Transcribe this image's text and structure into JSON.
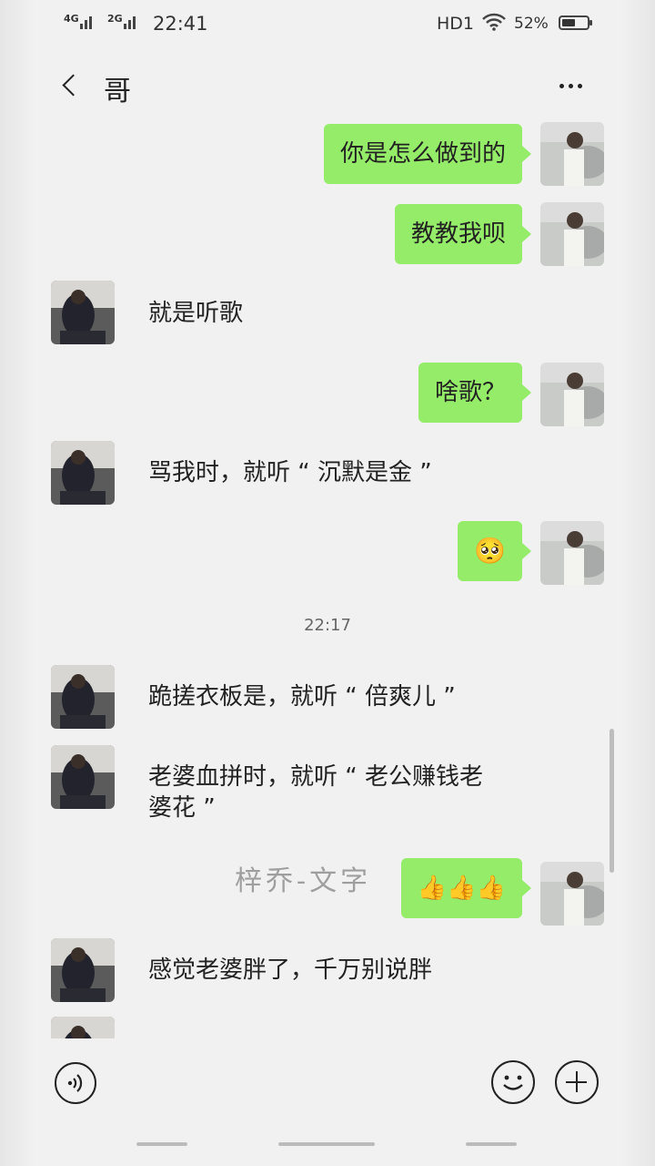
{
  "status_bar": {
    "signal1": "4G",
    "signal2": "2G",
    "time": "22:41",
    "hd": "HD1",
    "battery": "52%",
    "battery_level": 0.52
  },
  "header": {
    "title": "哥"
  },
  "messages": [
    {
      "side": "right",
      "text": "你是怎么做到的"
    },
    {
      "side": "right",
      "text": "教教我呗"
    },
    {
      "side": "left",
      "text": "就是听歌"
    },
    {
      "side": "right",
      "text": "啥歌？"
    },
    {
      "side": "left",
      "text": "骂我时，就听 “ 沉默是金 ”"
    },
    {
      "side": "right",
      "emoji": "flushed-face",
      "text": "🥺"
    },
    {
      "timestamp": "22:17"
    },
    {
      "side": "left",
      "text": "跪搓衣板是，就听 “ 倍爽儿 ”"
    },
    {
      "side": "left",
      "text": "老婆血拼时，就听 “ 老公赚钱老\n婆花 ”"
    },
    {
      "side": "right",
      "emoji": "thumbs-up",
      "text": "👍👍👍"
    },
    {
      "side": "left",
      "text": "感觉老婆胖了，千万别说胖"
    }
  ],
  "watermark": "梓乔-文字",
  "icons": {
    "back": "chevron-left-icon",
    "more": "more-dots-icon",
    "voice": "voice-icon",
    "emoji": "emoji-icon",
    "plus": "plus-icon"
  },
  "colors": {
    "bubble_right": "#95ec69",
    "background": "#f1f1f1"
  }
}
